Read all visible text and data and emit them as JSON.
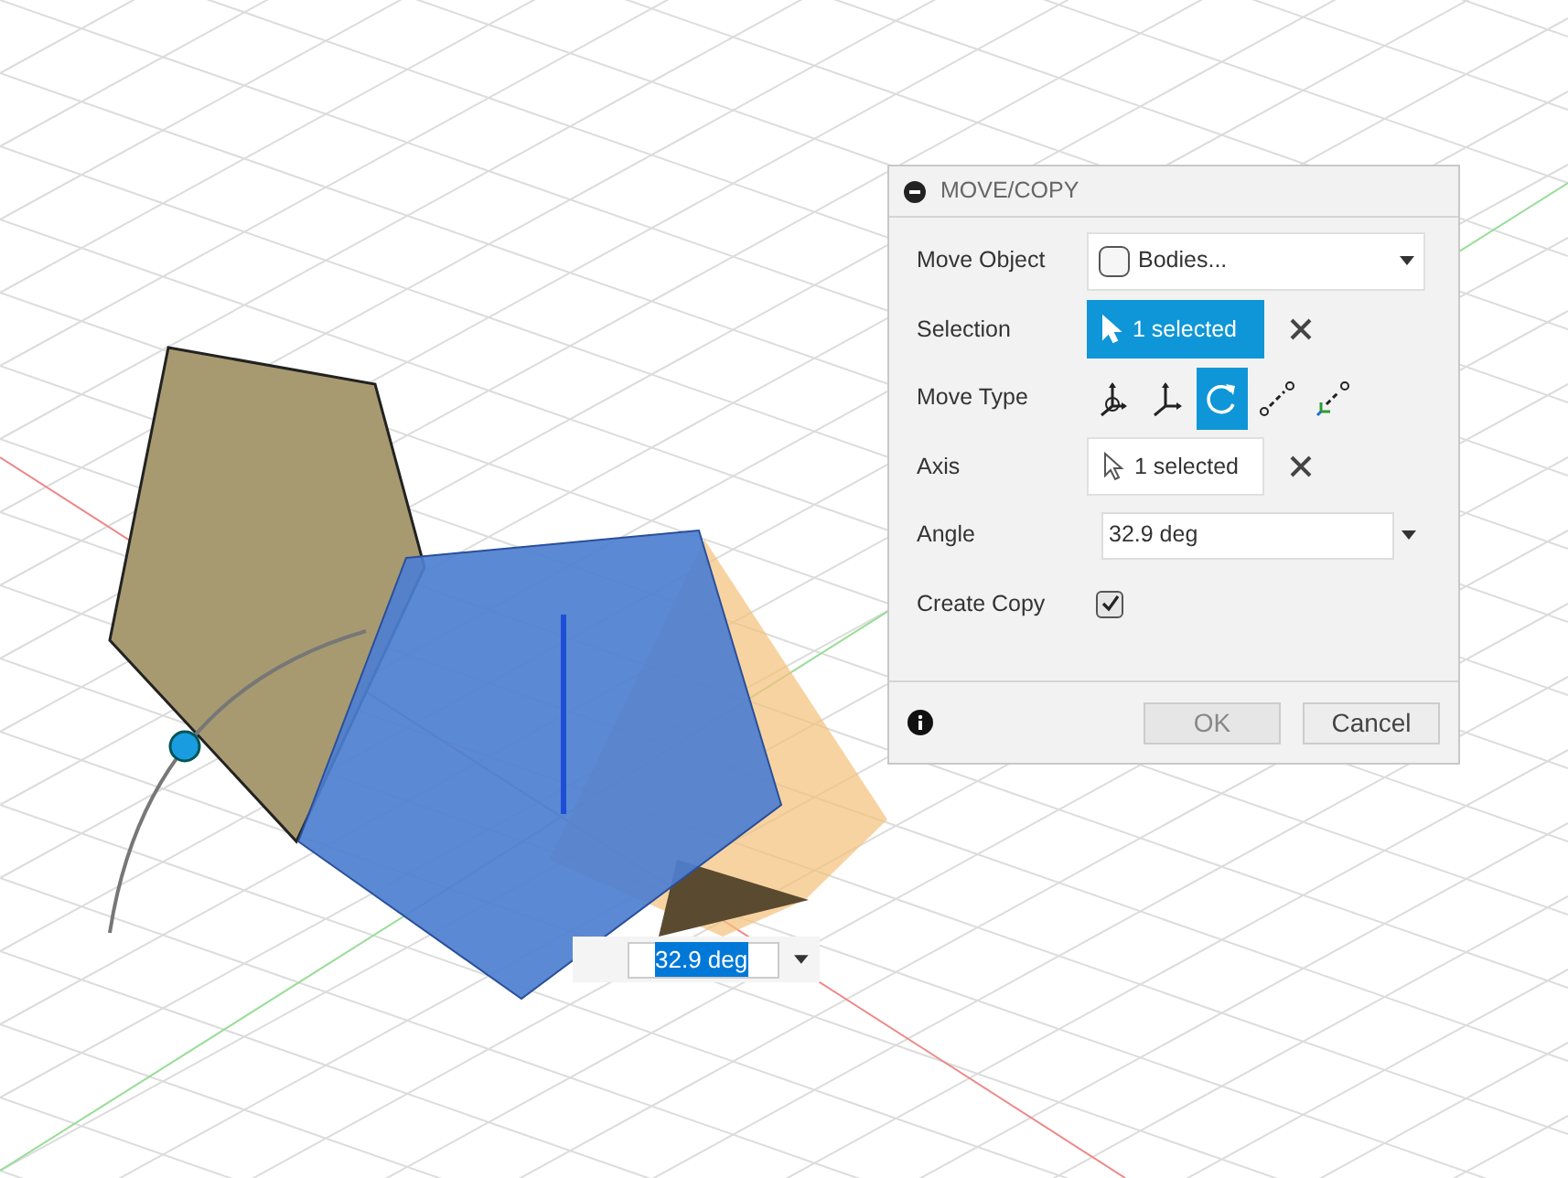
{
  "dialog": {
    "title": "MOVE/COPY",
    "expanded": true,
    "rows": [
      {
        "kind": "dropdown",
        "label": "Move Object",
        "value": "Bodies..."
      },
      {
        "kind": "selection",
        "label": "Selection",
        "value": "1 selected",
        "active": true
      },
      {
        "kind": "move_type",
        "label": "Move Type",
        "options": [
          {
            "kind": "free",
            "selected": false
          },
          {
            "kind": "translate",
            "selected": false
          },
          {
            "kind": "rotate",
            "selected": true
          },
          {
            "kind": "point_to_point",
            "selected": false
          },
          {
            "kind": "point_to_position",
            "selected": false
          }
        ]
      },
      {
        "kind": "selection",
        "label": "Axis",
        "value": "1 selected",
        "active": false
      },
      {
        "kind": "value",
        "label": "Angle",
        "value": "32.9 deg"
      },
      {
        "kind": "checkbox",
        "label": "Create Copy",
        "checked": true
      }
    ],
    "buttons": [
      {
        "label": "OK",
        "disabled": true
      },
      {
        "label": "Cancel",
        "disabled": false
      }
    ]
  },
  "angle_input": {
    "value": "32.9 deg",
    "highlighted": true
  }
}
